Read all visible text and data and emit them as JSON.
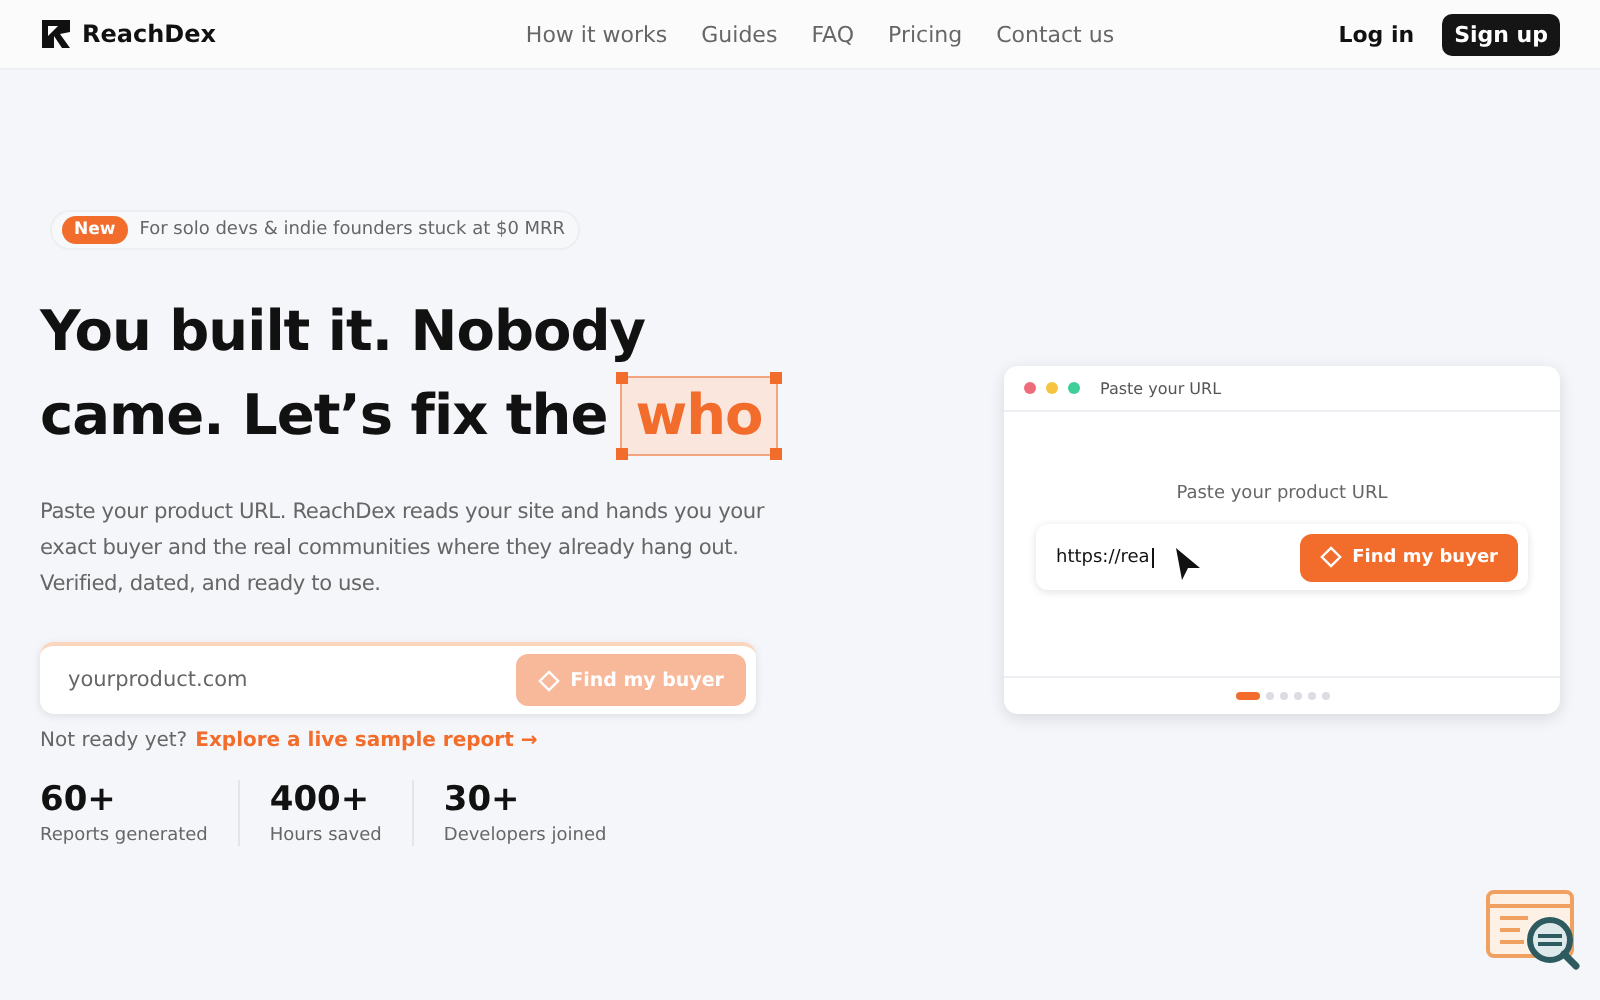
{
  "nav": {
    "brand": "ReachDex",
    "links": [
      "How it works",
      "Guides",
      "FAQ",
      "Pricing",
      "Contact us"
    ],
    "login": "Log in",
    "signup": "Sign up"
  },
  "hero": {
    "badge": "New",
    "tagline": "For solo devs & indie founders stuck at $0 MRR",
    "headline_lines": [
      "You built it. Nobody",
      "came. Let’s fix the"
    ],
    "highlight": "who",
    "description": "Paste your product URL. ReachDex reads your site and hands you your exact buyer and the real communities where they already hang out. Verified, dated, and ready to use.",
    "form": {
      "placeholder": "yourproduct.com",
      "button": "Find my buyer",
      "disabled": true
    },
    "sample_prompt": "Not ready yet?",
    "sample_link": "Explore a live sample report →",
    "stats": [
      {
        "value": "60+",
        "label": "Reports generated"
      },
      {
        "value": "400+",
        "label": "Hours saved"
      },
      {
        "value": "30+",
        "label": "Developers joined"
      }
    ]
  },
  "demo": {
    "title": "Paste your URL",
    "dots": [
      {
        "color": "#f06b7a"
      },
      {
        "color": "#f5c542"
      },
      {
        "color": "#3fcf9a"
      }
    ],
    "prompt": "Paste your product URL",
    "value": "https://rea",
    "button": "Find my buyer",
    "slides": [
      {
        "selected": true
      },
      {
        "selected": false
      },
      {
        "selected": false
      },
      {
        "selected": false
      },
      {
        "selected": false
      },
      {
        "selected": false
      }
    ]
  }
}
